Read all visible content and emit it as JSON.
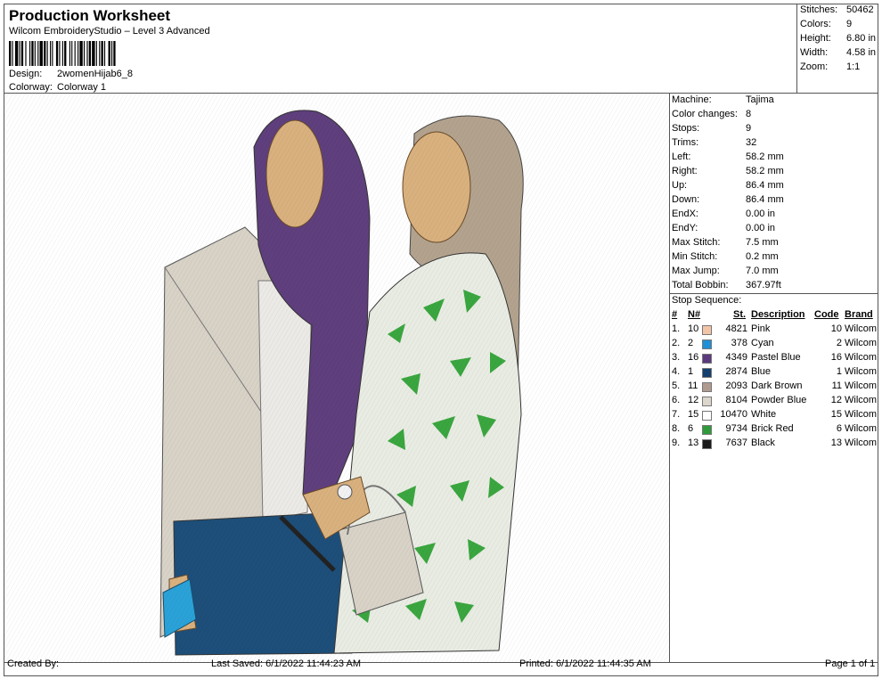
{
  "header": {
    "title": "Production Worksheet",
    "software": "Wilcom EmbroideryStudio – Level 3 Advanced",
    "design_label": "Design:",
    "design_value": "2womenHijab6_8",
    "colorway_label": "Colorway:",
    "colorway_value": "Colorway 1"
  },
  "summary": [
    {
      "label": "Stitches:",
      "value": "50462"
    },
    {
      "label": "Colors:",
      "value": "9"
    },
    {
      "label": "Height:",
      "value": "6.80 in"
    },
    {
      "label": "Width:",
      "value": "4.58 in"
    },
    {
      "label": "Zoom:",
      "value": "1:1"
    }
  ],
  "machine_info": [
    {
      "label": "Machine:",
      "value": "Tajima"
    },
    {
      "label": "Color changes:",
      "value": "8"
    },
    {
      "label": "Stops:",
      "value": "9"
    },
    {
      "label": "Trims:",
      "value": "32"
    },
    {
      "label": "Left:",
      "value": "58.2 mm"
    },
    {
      "label": "Right:",
      "value": "58.2 mm"
    },
    {
      "label": "Up:",
      "value": "86.4 mm"
    },
    {
      "label": "Down:",
      "value": "86.4 mm"
    },
    {
      "label": "EndX:",
      "value": "0.00 in"
    },
    {
      "label": "EndY:",
      "value": "0.00 in"
    },
    {
      "label": "Max Stitch:",
      "value": "7.5 mm"
    },
    {
      "label": "Min Stitch:",
      "value": "0.2 mm"
    },
    {
      "label": "Max Jump:",
      "value": "7.0 mm"
    },
    {
      "label": "Total Bobbin:",
      "value": "367.97ft"
    }
  ],
  "stop_sequence": {
    "title": "Stop Sequence:",
    "headers": {
      "num": "#",
      "n": "N#",
      "st": "St.",
      "description": "Description",
      "code": "Code",
      "brand": "Brand"
    },
    "rows": [
      {
        "num": "1.",
        "n": "10",
        "color": "#f2c4a6",
        "st": "4821",
        "description": "Pink",
        "code": "10",
        "brand": "Wilcom"
      },
      {
        "num": "2.",
        "n": "2",
        "color": "#1f8fd6",
        "st": "378",
        "description": "Cyan",
        "code": "2",
        "brand": "Wilcom"
      },
      {
        "num": "3.",
        "n": "16",
        "color": "#5c3a7e",
        "st": "4349",
        "description": "Pastel Blue",
        "code": "16",
        "brand": "Wilcom"
      },
      {
        "num": "4.",
        "n": "1",
        "color": "#13406e",
        "st": "2874",
        "description": "Blue",
        "code": "1",
        "brand": "Wilcom"
      },
      {
        "num": "5.",
        "n": "11",
        "color": "#b09a8e",
        "st": "2093",
        "description": "Dark Brown",
        "code": "11",
        "brand": "Wilcom"
      },
      {
        "num": "6.",
        "n": "12",
        "color": "#dcd6cc",
        "st": "8104",
        "description": "Powder Blue",
        "code": "12",
        "brand": "Wilcom"
      },
      {
        "num": "7.",
        "n": "15",
        "color": "#ffffff",
        "st": "10470",
        "description": "White",
        "code": "15",
        "brand": "Wilcom"
      },
      {
        "num": "8.",
        "n": "6",
        "color": "#2f9a3a",
        "st": "9734",
        "description": "Brick Red",
        "code": "6",
        "brand": "Wilcom"
      },
      {
        "num": "9.",
        "n": "13",
        "color": "#1a1a1a",
        "st": "7637",
        "description": "Black",
        "code": "13",
        "brand": "Wilcom"
      }
    ]
  },
  "footer": {
    "created_by": "Created By:",
    "last_saved": "Last Saved: 6/1/2022 11:44:23 AM",
    "printed": "Printed: 6/1/2022 11:44:35 AM",
    "page": "Page 1 of 1"
  }
}
